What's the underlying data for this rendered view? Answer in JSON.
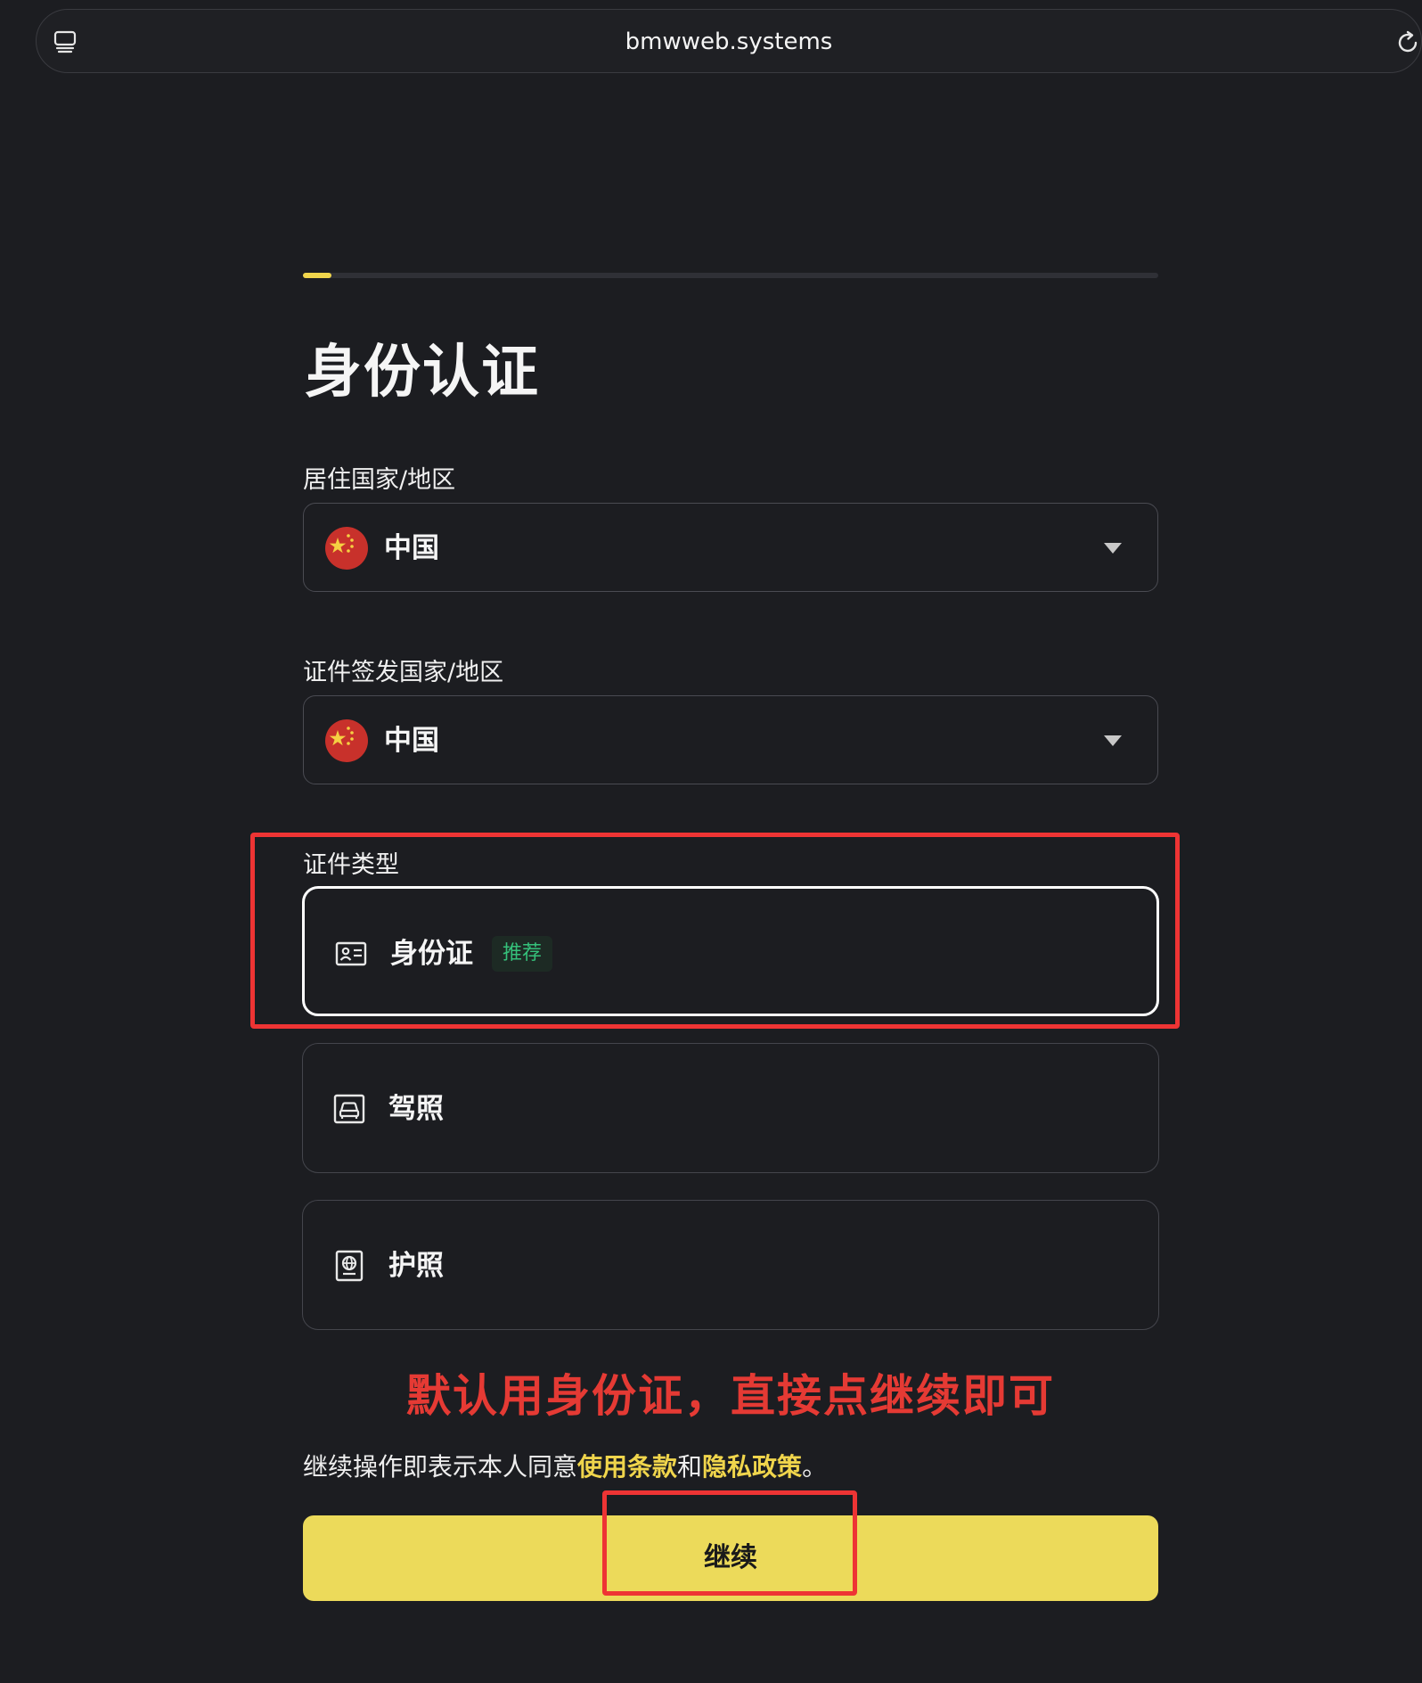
{
  "browser": {
    "url": "bmwweb.systems"
  },
  "progress": {
    "fraction": 0.033,
    "color": "#f0d54c"
  },
  "title": "身份认证",
  "residence": {
    "label": "居住国家/地区",
    "value": "中国",
    "flag_icon": "china-flag-icon"
  },
  "issuing": {
    "label": "证件签发国家/地区",
    "value": "中国",
    "flag_icon": "china-flag-icon"
  },
  "doc_type": {
    "label": "证件类型",
    "options": [
      {
        "label": "身份证",
        "badge": "推荐",
        "icon": "id-card-icon",
        "selected": true
      },
      {
        "label": "驾照",
        "icon": "driver-license-icon",
        "selected": false
      },
      {
        "label": "护照",
        "icon": "passport-icon",
        "selected": false
      }
    ]
  },
  "annotation": {
    "text": "默认用身份证，直接点继续即可",
    "color": "#e53a34"
  },
  "terms": {
    "prefix": "继续操作即表示本人同意",
    "terms_link": "使用条款",
    "conj": "和",
    "privacy_link": "隐私政策",
    "suffix": "。"
  },
  "continue_button": {
    "label": "继续",
    "color": "#ecda5a"
  }
}
